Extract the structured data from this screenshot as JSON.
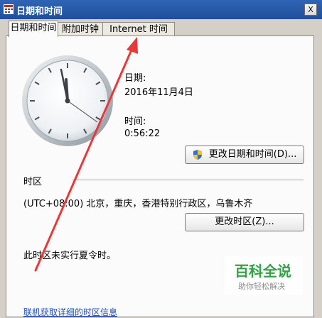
{
  "window": {
    "title": "日期和时间",
    "close_glyph": "X"
  },
  "tabs": [
    {
      "label": "日期和时间"
    },
    {
      "label": "附加时钟"
    },
    {
      "label": "Internet 时间"
    }
  ],
  "date_section": {
    "label": "日期:",
    "value": "2016年11月4日"
  },
  "time_section": {
    "label": "时间:",
    "value": "0:56:22"
  },
  "buttons": {
    "change_datetime": "更改日期和时间(D)...",
    "change_timezone": "更改时区(Z)..."
  },
  "timezone": {
    "heading": "时区",
    "value": "(UTC+08:00) 北京，重庆，香港特别行政区，乌鲁木齐",
    "dst_note": "此时区未实行夏令时。"
  },
  "link": "联机获取详细的时区信息",
  "watermark": {
    "title": "百科全说",
    "subtitle": "助你轻松解决"
  },
  "colors": {
    "titlebar": "#1f4f9c",
    "annotation_arrow": "#e8383a",
    "watermark_green": "#2a9e3f"
  },
  "icons": [
    "window-icon",
    "close-icon",
    "clock-icon",
    "shield-icon"
  ]
}
